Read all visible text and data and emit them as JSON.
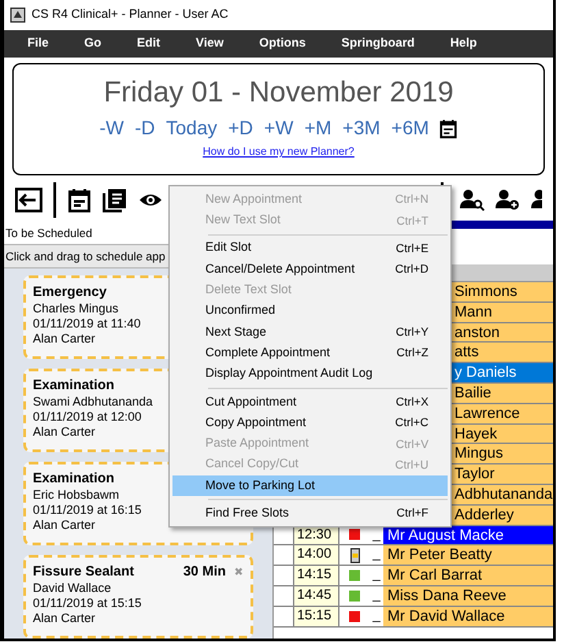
{
  "window": {
    "title": "CS R4 Clinical+ - Planner - User AC"
  },
  "menu_bar": [
    "File",
    "Go",
    "Edit",
    "View",
    "Options",
    "Springboard",
    "Help"
  ],
  "date_panel": {
    "date": "Friday 01 - November 2019",
    "nav": [
      "-W",
      "-D",
      "Today",
      "+D",
      "+W",
      "+M",
      "+3M",
      "+6M"
    ],
    "help_link": "How do I use my new Planner?"
  },
  "left_panel": {
    "title": "To be Scheduled",
    "hint": "Click and drag to schedule app",
    "cards": [
      {
        "type": "Emergency",
        "patient": "Charles Mingus",
        "when": "01/11/2019 at 11:40",
        "clinician": "Alan Carter"
      },
      {
        "type": "Examination",
        "patient": "Swami Adbhutananda",
        "when": "01/11/2019 at 12:00",
        "clinician": "Alan Carter"
      },
      {
        "type": "Examination",
        "patient": "Eric Hobsbawm",
        "when": "01/11/2019 at 16:15",
        "clinician": "Alan Carter"
      },
      {
        "type": "Fissure Sealant",
        "duration": "30 Min",
        "close": "✖",
        "patient": "David Wallace",
        "when": "01/11/2019 at 15:15",
        "clinician": "Alan Carter"
      }
    ]
  },
  "schedule": {
    "rows": [
      {
        "name": "Simmons",
        "selected": false
      },
      {
        "name": "Mann",
        "selected": false
      },
      {
        "name": "anston",
        "selected": false
      },
      {
        "name": "atts",
        "selected": false
      },
      {
        "name": "y Daniels",
        "selected": true
      },
      {
        "name": "Bailie",
        "selected": false
      },
      {
        "name": "Lawrence",
        "selected": false
      },
      {
        "name": "Hayek",
        "selected": false
      },
      {
        "name": "Mingus",
        "selected": false
      },
      {
        "name": "Taylor",
        "selected": false
      },
      {
        "name": "Adbhutananda",
        "selected": false
      },
      {
        "name": "Adderley",
        "selected": false
      },
      {
        "time": "12:30",
        "kind": "square",
        "color": "#ee1111",
        "mark": "_",
        "name": "Mr August Macke",
        "selected": true
      },
      {
        "time": "14:00",
        "kind": "pager",
        "mark": "_",
        "name": "Mr Peter Beatty",
        "selected": false
      },
      {
        "time": "14:15",
        "kind": "square",
        "color": "#66bb33",
        "mark": "_",
        "name": "Mr Carl Barrat",
        "selected": false
      },
      {
        "time": "14:45",
        "kind": "square",
        "color": "#66bb33",
        "mark": "_",
        "name": "Miss Dana Reeve",
        "selected": false
      },
      {
        "time": "15:15",
        "kind": "square",
        "color": "#ee1111",
        "mark": "_",
        "name": "Mr David Wallace",
        "selected": false
      }
    ]
  },
  "context_menu": [
    {
      "kind": "item",
      "label": "New Appointment",
      "shortcut": "Ctrl+N",
      "disabled": true,
      "selected": false
    },
    {
      "kind": "item",
      "label": "New Text Slot",
      "shortcut": "Ctrl+T",
      "disabled": true,
      "selected": false
    },
    {
      "kind": "separator"
    },
    {
      "kind": "item",
      "label": "Edit Slot",
      "shortcut": "Ctrl+E",
      "disabled": false,
      "selected": false
    },
    {
      "kind": "item",
      "label": "Cancel/Delete Appointment",
      "shortcut": "Ctrl+D",
      "disabled": false,
      "selected": false
    },
    {
      "kind": "item",
      "label": "Delete Text Slot",
      "disabled": true,
      "selected": false
    },
    {
      "kind": "item",
      "label": "Unconfirmed",
      "disabled": false,
      "selected": false
    },
    {
      "kind": "item",
      "label": "Next Stage",
      "shortcut": "Ctrl+Y",
      "disabled": false,
      "selected": false
    },
    {
      "kind": "item",
      "label": "Complete Appointment",
      "shortcut": "Ctrl+Z",
      "disabled": false,
      "selected": false
    },
    {
      "kind": "item",
      "label": "Display Appointment Audit Log",
      "disabled": false,
      "selected": false
    },
    {
      "kind": "separator"
    },
    {
      "kind": "item",
      "label": "Cut Appointment",
      "shortcut": "Ctrl+X",
      "disabled": false,
      "selected": false
    },
    {
      "kind": "item",
      "label": "Copy Appointment",
      "shortcut": "Ctrl+C",
      "disabled": false,
      "selected": false
    },
    {
      "kind": "item",
      "label": "Paste Appointment",
      "shortcut": "Ctrl+V",
      "disabled": true,
      "selected": false
    },
    {
      "kind": "item",
      "label": "Cancel Copy/Cut",
      "shortcut": "Ctrl+U",
      "disabled": true,
      "selected": false
    },
    {
      "kind": "item",
      "label": "Move to Parking Lot",
      "disabled": false,
      "selected": true
    },
    {
      "kind": "separator"
    },
    {
      "kind": "item",
      "label": "Find Free Slots",
      "shortcut": "Ctrl+F",
      "disabled": false,
      "selected": false
    }
  ]
}
